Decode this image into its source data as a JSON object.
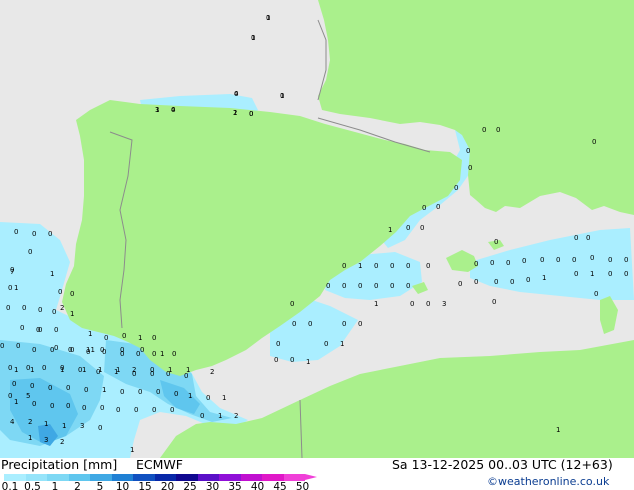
{
  "legend": {
    "title": "Precipitation [mm]",
    "model": "ECMWF",
    "valid": "Sa 13-12-2025 00..03 UTC (12+63)",
    "credit": "©weatheronline.co.uk",
    "ticks": [
      "0.1",
      "0.5",
      "1",
      "2",
      "5",
      "10",
      "15",
      "20",
      "25",
      "30",
      "35",
      "40",
      "45",
      "50"
    ],
    "colors": [
      "#aaeeff",
      "#96e4fa",
      "#7ed8f4",
      "#5fc6ee",
      "#3fa8e4",
      "#1f80d4",
      "#1050c0",
      "#0828a8",
      "#100890",
      "#5a10c8",
      "#9010d8",
      "#c010d0",
      "#e018c8",
      "#f040d8"
    ]
  },
  "map_colors": {
    "sea": "#e8e8e8",
    "land": "#aaf08c",
    "border": "#8c8c8c",
    "precip_light": "#aaeeff",
    "precip_mid": "#7ed8f4",
    "precip_strong": "#5fc6ee",
    "precip_heavy": "#3fa8e4"
  },
  "values": [
    "0",
    "0",
    "0",
    "3",
    "0",
    "1",
    "0",
    "0",
    "0",
    "0",
    "0",
    "0",
    "0",
    "0",
    "0",
    "0",
    "0",
    "1",
    "0",
    "0",
    "0",
    "0",
    "0",
    "1",
    "0",
    "0",
    "0",
    "0",
    "0",
    "0",
    "0",
    "0",
    "0",
    "0",
    "0",
    "0",
    "0",
    "0",
    "0",
    "0",
    "0",
    "0",
    "0",
    "0",
    "0",
    "0",
    "0",
    "0",
    "0",
    "1",
    "0",
    "1",
    "0",
    "0",
    "0",
    "0",
    "0",
    "0",
    "3",
    "1",
    "0",
    "0",
    "0",
    "0",
    "0",
    "1",
    "0",
    "0",
    "0",
    "0",
    "1",
    "0",
    "0",
    "0",
    "0",
    "0",
    "0",
    "0",
    "0",
    "0",
    "0",
    "0",
    "0",
    "0",
    "0",
    "0",
    "1",
    "0",
    "0",
    "1",
    "0",
    "0",
    "0",
    "0",
    "0",
    "0",
    "0",
    "0",
    "0",
    "0",
    "0",
    "0",
    "0",
    "0",
    "0",
    "0",
    "0",
    "0",
    "1",
    "0",
    "0",
    "0",
    "0",
    "0",
    "0",
    "0",
    "0",
    "0",
    "1",
    "0",
    "0",
    "0",
    "0",
    "1",
    "0",
    "1",
    "1",
    "0",
    "0",
    "0",
    "0",
    "0",
    "0",
    "0",
    "0",
    "0",
    "0",
    "1",
    "2",
    "4",
    "2",
    "1",
    "1",
    "3",
    "0",
    "1",
    "3",
    "2",
    "1",
    "1",
    "2",
    "1",
    "7",
    "1",
    "1",
    "0",
    "0",
    "0",
    "11",
    "0",
    "0",
    "0",
    "1",
    "1",
    "1",
    "1",
    "1",
    "2",
    "0",
    "1",
    "1",
    "2",
    "1",
    "1",
    "0",
    "5",
    "1",
    "1",
    "4",
    "1",
    "4",
    "2",
    "0",
    "1"
  ]
}
